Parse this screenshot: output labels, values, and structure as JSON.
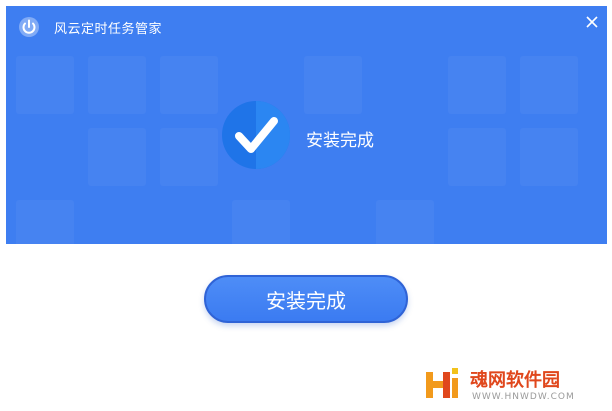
{
  "window": {
    "title": "风云定时任务管家",
    "icons": {
      "logo": "power-icon",
      "close": "close-icon",
      "status": "checkmark-icon"
    }
  },
  "main": {
    "status_text": "安装完成",
    "finish_button_label": "安装完成"
  },
  "watermark": {
    "title": "魂网软件园",
    "url": "WWW.HNWDW.COM"
  },
  "colors": {
    "header_blue": "#3e7ef1",
    "button_blue": "#4a8af6",
    "watermark_orange": "#e0471c"
  }
}
